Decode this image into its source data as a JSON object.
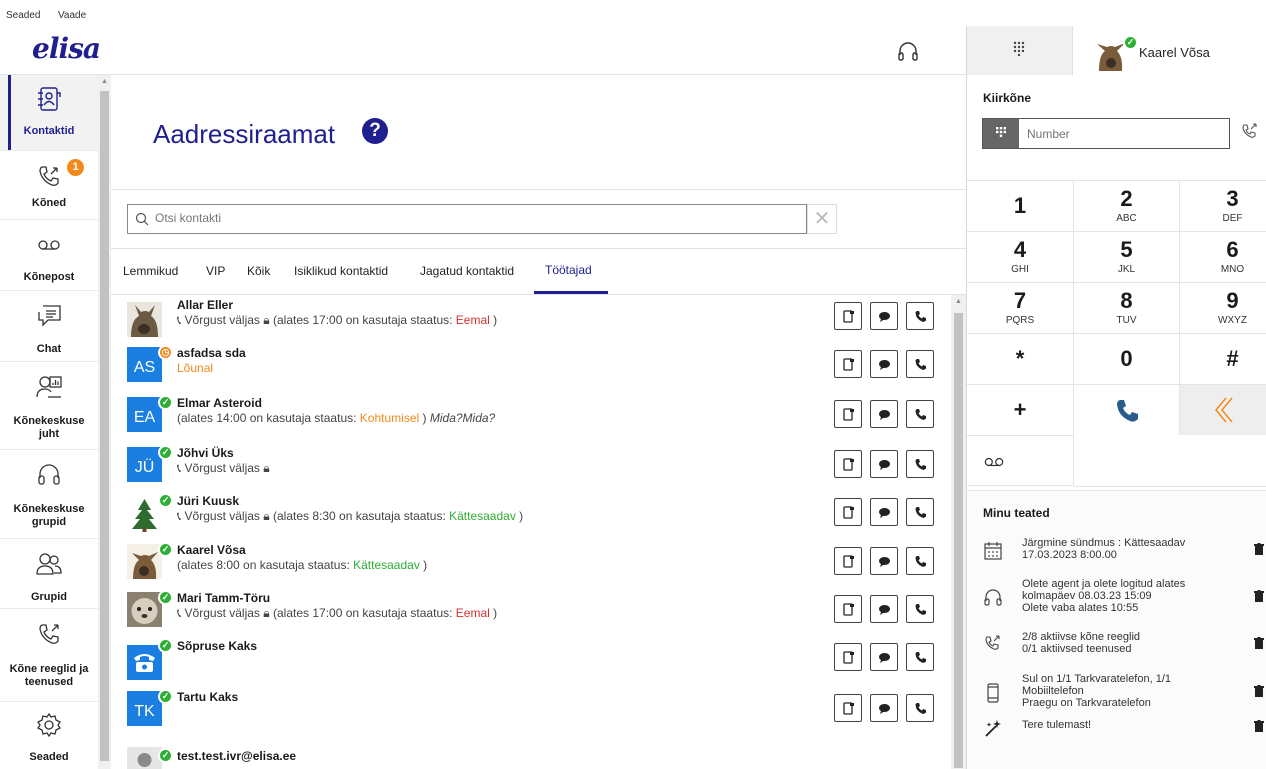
{
  "menubar": {
    "settings": "Seaded",
    "view": "Vaade"
  },
  "brand": {
    "logo": "elisa",
    "color": "#1f1f8f"
  },
  "sidebar": {
    "items": [
      {
        "label": "Kontaktid",
        "icon": "contacts-icon",
        "active": true
      },
      {
        "label": "Kõned",
        "icon": "calls-icon",
        "badge": "1"
      },
      {
        "label": "Kõnepost",
        "icon": "voicemail-icon"
      },
      {
        "label": "Chat",
        "icon": "chat-icon"
      },
      {
        "label": "Kõnekeskuse juht",
        "icon": "callcenter-manager-icon"
      },
      {
        "label": "Kõnekeskuse grupid",
        "icon": "headset-icon"
      },
      {
        "label": "Grupid",
        "icon": "groups-icon"
      },
      {
        "label": "Kõne reeglid ja teenused",
        "icon": "call-rules-icon"
      },
      {
        "label": "Seaded",
        "icon": "gear-icon"
      }
    ]
  },
  "main": {
    "title": "Aadressiraamat",
    "help": "?",
    "search_placeholder": "Otsi kontakti",
    "tabs": [
      "Lemmikud",
      "VIP",
      "Kõik",
      "Isiklikud kontaktid",
      "Jagatud kontaktid",
      "Töötajad"
    ],
    "active_tab": "Töötajad",
    "contacts": [
      {
        "name": "Allar Eller",
        "avatar": "photo",
        "status_prefix": "Võrgust väljas",
        "locked": true,
        "detail_before": "(alates 17:00 on kasutaja staatus: ",
        "detail_status": "Eemal",
        "detail_after": ")",
        "detail_color": "red"
      },
      {
        "name": "asfadsa sda",
        "avatar": "AS",
        "dot": "orange",
        "status_text": "Lõunal"
      },
      {
        "name": "Elmar Asteroid",
        "avatar": "EA",
        "dot": "green",
        "detail_before": "(alates 14:00 on kasutaja staatus: ",
        "detail_status": "Kohtumisel",
        "detail_after": ") ",
        "note": "Mida?Mida?",
        "detail_color": "orange"
      },
      {
        "name": "Jõhvi Üks",
        "avatar": "JÜ",
        "dot": "green",
        "status_prefix": "Võrgust väljas",
        "locked": true
      },
      {
        "name": "Jüri Kuusk",
        "avatar": "tree",
        "dot": "green",
        "status_prefix": "Võrgust väljas",
        "locked": true,
        "detail_before": "(alates 8:30 on kasutaja staatus: ",
        "detail_status": "Kättesaadav",
        "detail_after": ")",
        "detail_color": "green"
      },
      {
        "name": "Kaarel Võsa",
        "avatar": "photo",
        "dot": "green",
        "detail_before": "(alates 8:00 on kasutaja staatus: ",
        "detail_status": "Kättesaadav",
        "detail_after": ")",
        "detail_color": "green"
      },
      {
        "name": "Mari Tamm-Töru",
        "avatar": "photo",
        "dot": "green",
        "status_prefix": "Võrgust väljas",
        "locked": true,
        "detail_before": "(alates 17:00 on kasutaja staatus: ",
        "detail_status": "Eemal",
        "detail_after": ")",
        "detail_color": "red"
      },
      {
        "name": "Sõpruse Kaks",
        "avatar": "phone",
        "dot": "green"
      },
      {
        "name": "Tartu Kaks",
        "avatar": "TK",
        "dot": "green"
      },
      {
        "name": "test.test.ivr@elisa.ee",
        "avatar": "person",
        "dot": "green"
      }
    ]
  },
  "right_panel": {
    "user_name": "Kaarel Võsa",
    "quick_call_title": "Kiirkõne",
    "number_placeholder": "Number",
    "keys": [
      {
        "d": "1",
        "l": ""
      },
      {
        "d": "2",
        "l": "ABC"
      },
      {
        "d": "3",
        "l": "DEF"
      },
      {
        "d": "4",
        "l": "GHI"
      },
      {
        "d": "5",
        "l": "JKL"
      },
      {
        "d": "6",
        "l": "MNO"
      },
      {
        "d": "7",
        "l": "PQRS"
      },
      {
        "d": "8",
        "l": "TUV"
      },
      {
        "d": "9",
        "l": "WXYZ"
      },
      {
        "d": "*",
        "l": ""
      },
      {
        "d": "0",
        "l": ""
      },
      {
        "d": "#",
        "l": ""
      }
    ],
    "plus_key": "+",
    "notifications_title": "Minu teated",
    "notifications": [
      {
        "icon": "calendar-icon",
        "lines": [
          "Järgmine sündmus : Kättesaadav",
          "17.03.2023 8:00.00"
        ]
      },
      {
        "icon": "headset-icon",
        "lines": [
          "Olete agent ja olete logitud alates",
          "kolmapäev 08.03.23 15:09",
          "Olete vaba alates 10:55"
        ]
      },
      {
        "icon": "call-rules-icon",
        "lines": [
          "2/8 aktiivse kõne reeglid",
          "0/1 aktiivsed teenused"
        ]
      },
      {
        "icon": "mobile-icon",
        "lines": [
          "Sul on 1/1 Tarkvaratelefon, 1/1",
          "Mobiiltelefon",
          "Praegu on Tarkvaratelefon"
        ]
      },
      {
        "icon": "magic-wand-icon",
        "lines": [
          "Tere tulemast!"
        ]
      }
    ]
  }
}
